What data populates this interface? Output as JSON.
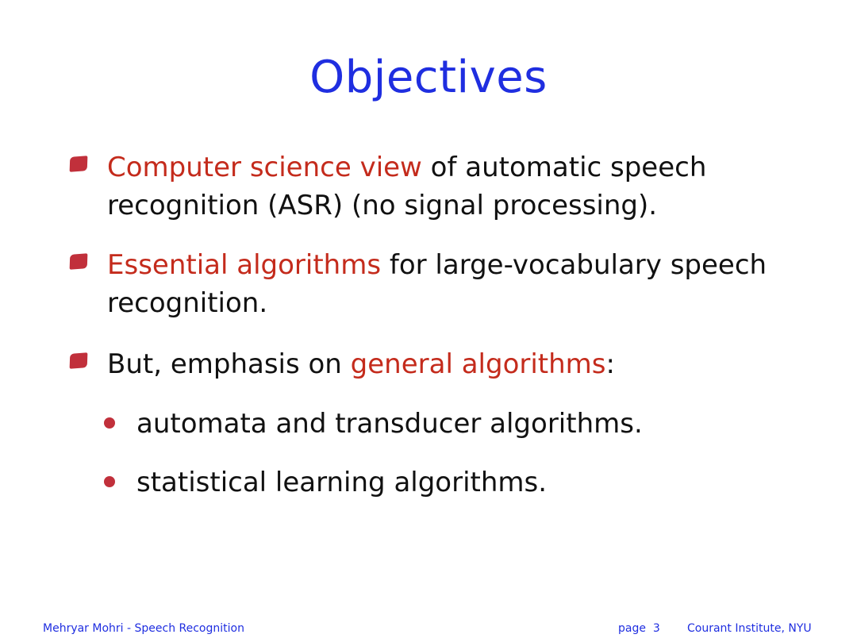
{
  "slide": {
    "title": "Objectives",
    "bullets": [
      {
        "highlight": "Computer science view",
        "rest_line1": " of automatic speech",
        "rest_line2": "recognition (ASR) (no signal processing)."
      },
      {
        "highlight": "Essential algorithms",
        "rest_line1": " for large-vocabulary speech",
        "rest_line2": "recognition."
      },
      {
        "lead": "But, emphasis on ",
        "highlight": "general algorithms",
        "tail": ":"
      }
    ],
    "sub_bullets": [
      "automata and transducer algorithms.",
      "statistical learning algorithms."
    ]
  },
  "footer": {
    "left": "Mehryar Mohri - Speech Recognition",
    "page_label": "page",
    "page_number": "3",
    "right": "Courant Institute, NYU"
  },
  "colors": {
    "title": "#1f2ee0",
    "highlight": "#c42b1c",
    "bullet_marker": "#c1303b",
    "footer_text": "#1f2ee0"
  },
  "icons": {
    "bullet_marker": "square-bullet-icon",
    "sub_bullet_marker": "dot-bullet-icon"
  }
}
